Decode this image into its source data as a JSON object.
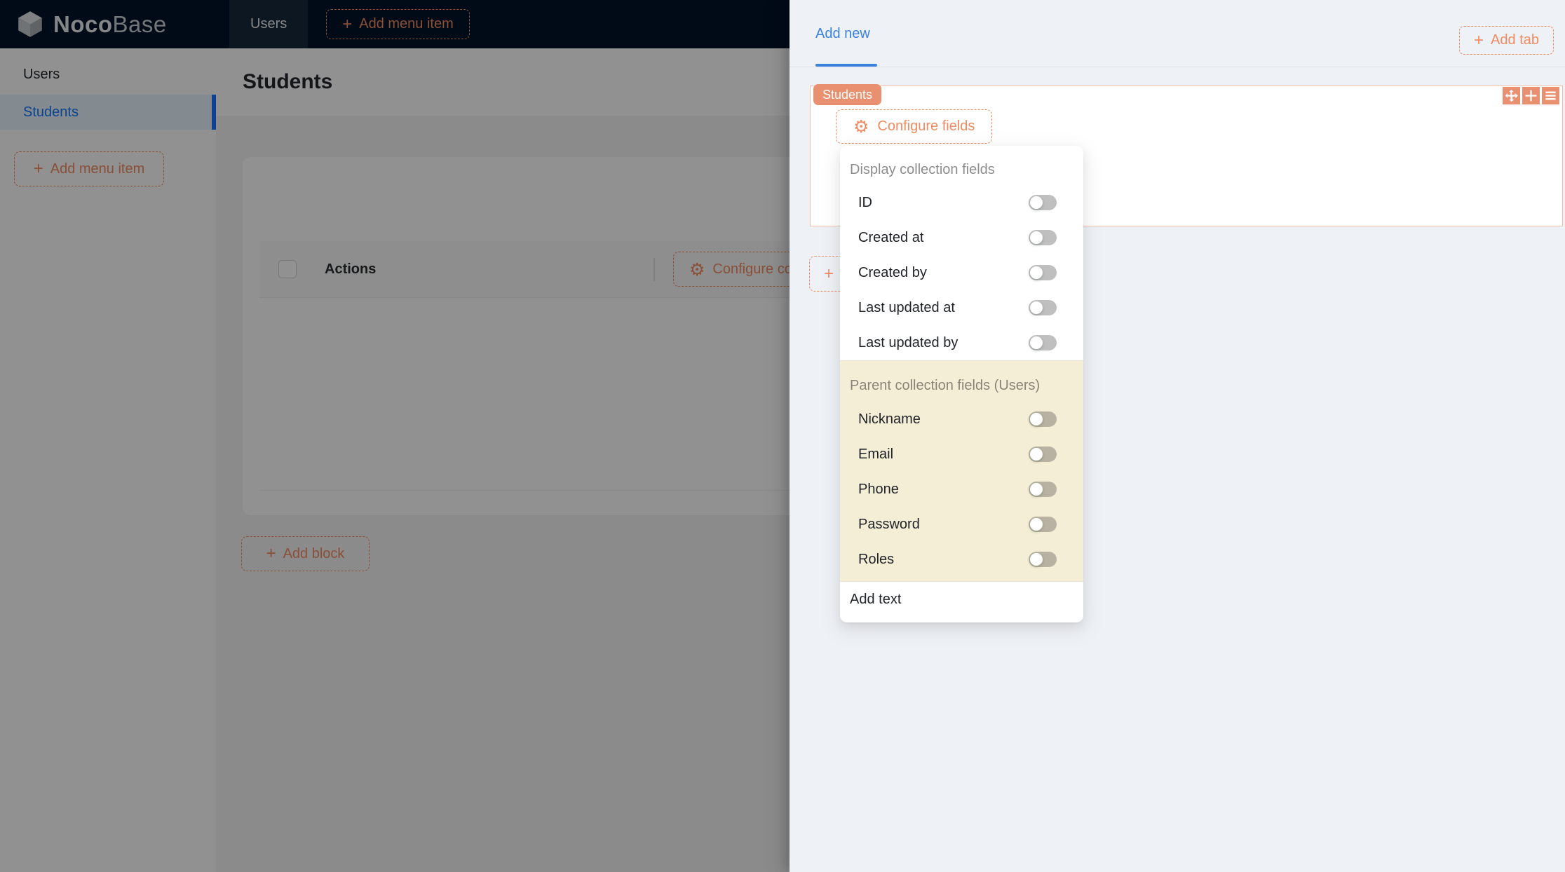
{
  "colors": {
    "header_bg": "#001529",
    "accent_orange": "#F18B62",
    "primary_blue": "#1677ff",
    "tab_blue": "#3b82e0",
    "cream_highlight": "#f5eed7",
    "drawer_bg": "#eef1f5"
  },
  "icons": {
    "plus": "+",
    "gear": "⚙"
  },
  "header": {
    "logo_noco": "Noco",
    "logo_base": "Base",
    "nav": [
      {
        "label": "Users",
        "selected": true
      }
    ],
    "add_menu_item_label": "Add menu item"
  },
  "sidebar": {
    "items": [
      {
        "label": "Users",
        "selected": false
      },
      {
        "label": "Students",
        "selected": true
      }
    ],
    "add_menu_item_label": "Add menu item"
  },
  "main": {
    "page_title": "Students",
    "table": {
      "columns": [
        {
          "label": "Actions"
        }
      ],
      "select_all_checked": false,
      "configure_columns_label": "Configure columns"
    },
    "add_block_label": "Add block"
  },
  "drawer": {
    "tabs": [
      {
        "label": "Add new",
        "selected": true
      }
    ],
    "add_tab_label": "Add tab",
    "block": {
      "badge": "Students",
      "configure_fields_label": "Configure fields",
      "toolbar_icons": [
        "drag-icon",
        "plus-icon",
        "menu-icon"
      ]
    },
    "fields_menu": {
      "groups": [
        {
          "title": "Display collection fields",
          "items": [
            {
              "label": "ID",
              "on": false
            },
            {
              "label": "Created at",
              "on": false
            },
            {
              "label": "Created by",
              "on": false
            },
            {
              "label": "Last updated at",
              "on": false
            },
            {
              "label": "Last updated by",
              "on": false
            }
          ]
        },
        {
          "title": "Parent collection fields (Users)",
          "items": [
            {
              "label": "Nickname",
              "on": false
            },
            {
              "label": "Email",
              "on": false
            },
            {
              "label": "Phone",
              "on": false
            },
            {
              "label": "Password",
              "on": false
            },
            {
              "label": "Roles",
              "on": false
            }
          ]
        }
      ],
      "footer_item_label": "Add text"
    }
  }
}
